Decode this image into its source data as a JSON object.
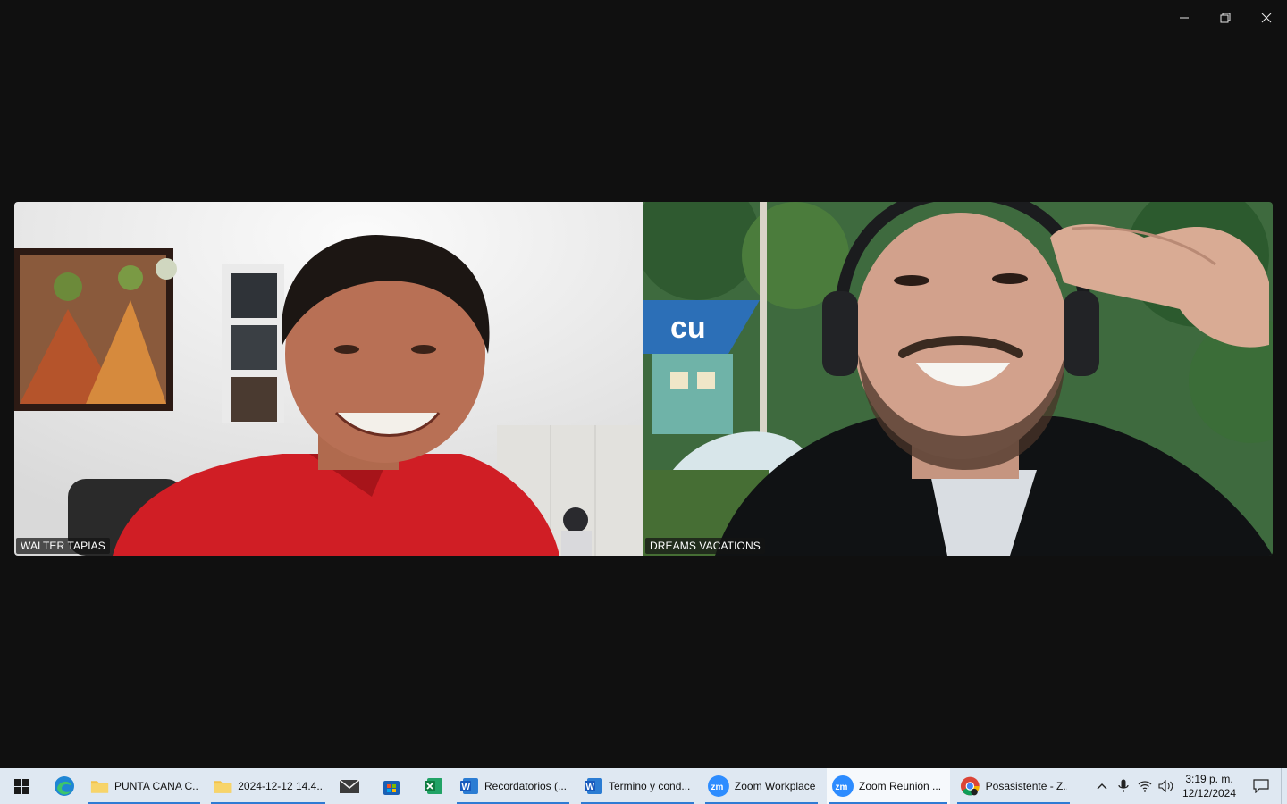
{
  "window": {
    "controls": [
      "minimize-icon",
      "restore-icon",
      "close-icon"
    ]
  },
  "participants": [
    {
      "name": "WALTER TAPIAS"
    },
    {
      "name": "DREAMS VACATIONS"
    }
  ],
  "taskbar": {
    "pinned": [
      "windows-start-icon",
      "edge-icon"
    ],
    "apps": [
      {
        "label": "PUNTA CANA C...",
        "icon": "folder-icon",
        "open": true
      },
      {
        "label": "2024-12-12 14.4...",
        "icon": "folder-icon",
        "open": true
      },
      {
        "label": "Recordatorios (...",
        "icon": "word-icon",
        "open": true
      },
      {
        "label": "Termino y cond...",
        "icon": "word-icon",
        "open": true
      },
      {
        "label": "Zoom Workplace",
        "icon": "zoom-icon",
        "open": true
      },
      {
        "label": "Zoom Reunión ...",
        "icon": "zoom-icon",
        "open": true,
        "active": true
      },
      {
        "label": "Posasistente - Z...",
        "icon": "chrome-icon",
        "open": true
      }
    ],
    "clock": {
      "time": "3:19 p. m.",
      "date": "12/12/2024"
    }
  },
  "colors": {
    "background": "#101010",
    "taskbar": "#dfe8f2",
    "accent": "#2e7bd4",
    "zoom_blue": "#2d8cff"
  }
}
